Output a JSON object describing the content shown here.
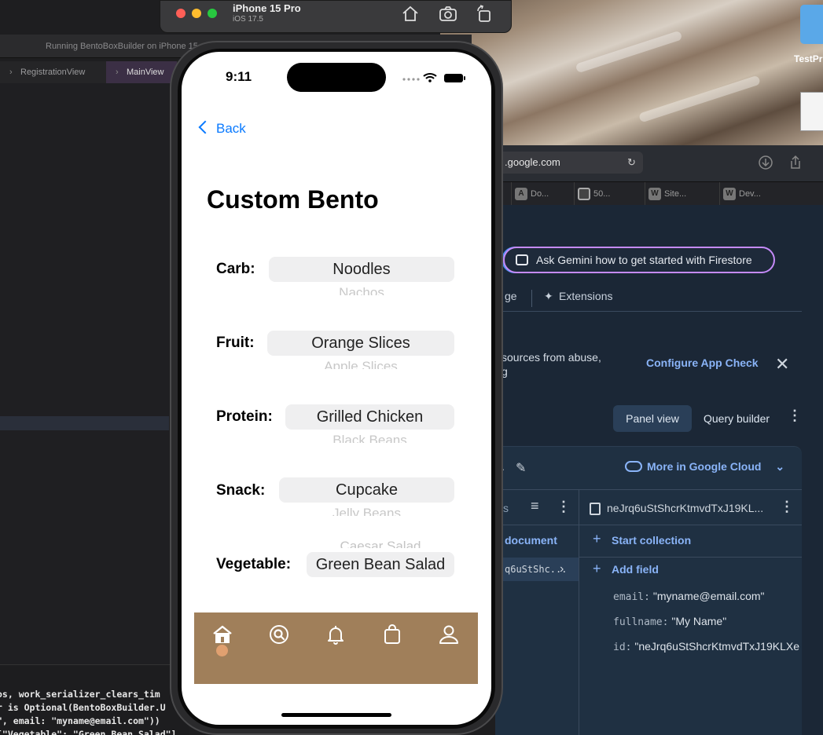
{
  "simulator": {
    "device": "iPhone 15 Pro",
    "os": "iOS 17.5",
    "icons": [
      "home-icon",
      "screenshot-icon",
      "rotate-icon"
    ]
  },
  "desktop": {
    "folder_label": "TestPr"
  },
  "xcode": {
    "status": "Running BentoBoxBuilder on iPhone 15",
    "tabs": [
      {
        "label": "RegistrationView"
      },
      {
        "label": "MainView"
      }
    ],
    "console_lines": [
      "os, work_serializer_clears_tim",
      "r is Optional(BentoBoxBuilder.U",
      "\", email: \"myname@email.com\"))",
      " [\"Vegetable\": \"Green Bean Salad\"]"
    ]
  },
  "browser": {
    "url": ".google.com",
    "tabs": [
      {
        "icon": "A",
        "label": "Do..."
      },
      {
        "icon": "",
        "label": "50..."
      },
      {
        "icon": "W",
        "label": "Site..."
      },
      {
        "icon": "W",
        "label": "Dev..."
      }
    ]
  },
  "firebase": {
    "gemini_button": "Ask Gemini how to get started with Firestore",
    "nav": {
      "partial": "ge",
      "extensions": "Extensions"
    },
    "appcheck_text_1": "sources from abuse,",
    "appcheck_text_2": "g",
    "appcheck_link": "Configure App Check",
    "panel_view": "Panel view",
    "query_builder": "Query builder",
    "more_cloud": "More in Google Cloud",
    "col1_partial": "s",
    "doc_id": "neJrq6uStShcrKtmvdTxJ19KL...",
    "add_document": "document",
    "start_collection": "Start collection",
    "add_field": "Add field",
    "selected_doc": "q6uStShc...",
    "fields": [
      {
        "key": "email:",
        "value": "\"myname@email.com\""
      },
      {
        "key": "fullname:",
        "value": "\"My Name\""
      },
      {
        "key": "id:",
        "value": "\"neJrq6uStShcrKtmvdTxJ19KLXe"
      }
    ]
  },
  "app": {
    "time": "9:11",
    "back": "Back",
    "title": "Custom Bento",
    "rows": [
      {
        "label": "Carb:",
        "selected": "Noodles",
        "below": "Nachos"
      },
      {
        "label": "Fruit:",
        "selected": "Orange Slices",
        "below": "Apple Slices"
      },
      {
        "label": "Protein:",
        "selected": "Grilled Chicken",
        "below": "Black Beans"
      },
      {
        "label": "Snack:",
        "selected": "Cupcake",
        "below": "Jelly Beans"
      },
      {
        "label": "Vegetable:",
        "selected": "Green Bean Salad",
        "above": "Caesar Salad"
      }
    ],
    "tabbar": {
      "color": "#a07f5a",
      "items": [
        "home-icon",
        "search-icon",
        "bell-icon",
        "bag-icon",
        "profile-icon"
      ]
    }
  }
}
